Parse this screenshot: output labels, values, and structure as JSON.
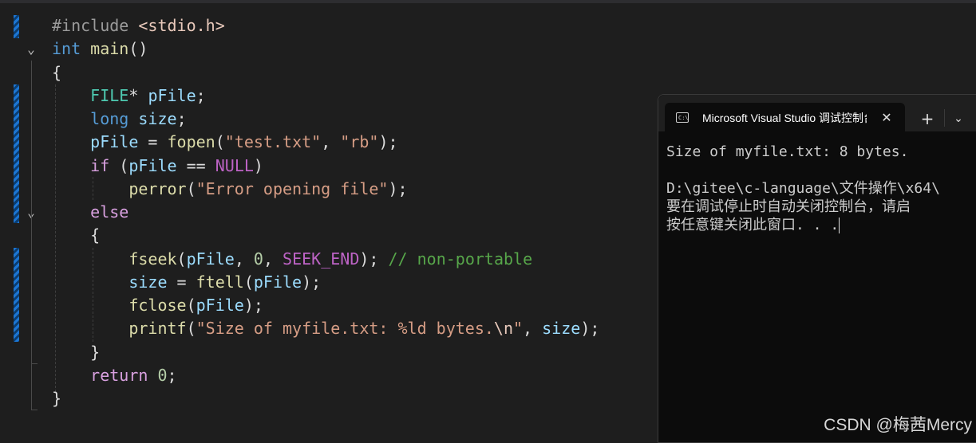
{
  "editor": {
    "code_lines": [
      [
        {
          "t": "#include ",
          "c": "pre"
        },
        {
          "t": "<stdio.h>",
          "c": "hdr"
        }
      ],
      [
        {
          "t": "int",
          "c": "kw"
        },
        {
          "t": " ",
          "c": "pun"
        },
        {
          "t": "main",
          "c": "fn"
        },
        {
          "t": "()",
          "c": "pun"
        }
      ],
      [
        {
          "t": "{",
          "c": "pun"
        }
      ],
      [
        {
          "t": "    ",
          "c": "pun"
        },
        {
          "t": "FILE",
          "c": "type"
        },
        {
          "t": "* ",
          "c": "pun"
        },
        {
          "t": "pFile",
          "c": "var"
        },
        {
          "t": ";",
          "c": "pun"
        }
      ],
      [
        {
          "t": "    ",
          "c": "pun"
        },
        {
          "t": "long",
          "c": "kw"
        },
        {
          "t": " ",
          "c": "pun"
        },
        {
          "t": "size",
          "c": "var"
        },
        {
          "t": ";",
          "c": "pun"
        }
      ],
      [
        {
          "t": "    ",
          "c": "pun"
        },
        {
          "t": "pFile",
          "c": "var"
        },
        {
          "t": " = ",
          "c": "pun"
        },
        {
          "t": "fopen",
          "c": "fn"
        },
        {
          "t": "(",
          "c": "pun"
        },
        {
          "t": "\"test.txt\"",
          "c": "str"
        },
        {
          "t": ", ",
          "c": "pun"
        },
        {
          "t": "\"rb\"",
          "c": "str"
        },
        {
          "t": ");",
          "c": "pun"
        }
      ],
      [
        {
          "t": "    ",
          "c": "pun"
        },
        {
          "t": "if",
          "c": "ctl"
        },
        {
          "t": " (",
          "c": "pun"
        },
        {
          "t": "pFile",
          "c": "var"
        },
        {
          "t": " == ",
          "c": "pun"
        },
        {
          "t": "NULL",
          "c": "mac"
        },
        {
          "t": ")",
          "c": "pun"
        }
      ],
      [
        {
          "t": "        ",
          "c": "pun"
        },
        {
          "t": "perror",
          "c": "fn"
        },
        {
          "t": "(",
          "c": "pun"
        },
        {
          "t": "\"Error opening file\"",
          "c": "str"
        },
        {
          "t": ");",
          "c": "pun"
        }
      ],
      [
        {
          "t": "    ",
          "c": "pun"
        },
        {
          "t": "else",
          "c": "ctl"
        }
      ],
      [
        {
          "t": "    {",
          "c": "pun"
        }
      ],
      [
        {
          "t": "        ",
          "c": "pun"
        },
        {
          "t": "fseek",
          "c": "fn"
        },
        {
          "t": "(",
          "c": "pun"
        },
        {
          "t": "pFile",
          "c": "var"
        },
        {
          "t": ", ",
          "c": "pun"
        },
        {
          "t": "0",
          "c": "num"
        },
        {
          "t": ", ",
          "c": "pun"
        },
        {
          "t": "SEEK_END",
          "c": "mac"
        },
        {
          "t": "); ",
          "c": "pun"
        },
        {
          "t": "// non-portable",
          "c": "cmt"
        }
      ],
      [
        {
          "t": "        ",
          "c": "pun"
        },
        {
          "t": "size",
          "c": "var"
        },
        {
          "t": " = ",
          "c": "pun"
        },
        {
          "t": "ftell",
          "c": "fn"
        },
        {
          "t": "(",
          "c": "pun"
        },
        {
          "t": "pFile",
          "c": "var"
        },
        {
          "t": ");",
          "c": "pun"
        }
      ],
      [
        {
          "t": "        ",
          "c": "pun"
        },
        {
          "t": "fclose",
          "c": "fn"
        },
        {
          "t": "(",
          "c": "pun"
        },
        {
          "t": "pFile",
          "c": "var"
        },
        {
          "t": ");",
          "c": "pun"
        }
      ],
      [
        {
          "t": "        ",
          "c": "pun"
        },
        {
          "t": "printf",
          "c": "fn"
        },
        {
          "t": "(",
          "c": "pun"
        },
        {
          "t": "\"Size of myfile.txt: %ld bytes.",
          "c": "str"
        },
        {
          "t": "\\n",
          "c": "esc"
        },
        {
          "t": "\"",
          "c": "str"
        },
        {
          "t": ", ",
          "c": "pun"
        },
        {
          "t": "size",
          "c": "var"
        },
        {
          "t": ");",
          "c": "pun"
        }
      ],
      [
        {
          "t": "    }",
          "c": "pun"
        }
      ],
      [
        {
          "t": "    ",
          "c": "pun"
        },
        {
          "t": "return",
          "c": "ctl"
        },
        {
          "t": " ",
          "c": "pun"
        },
        {
          "t": "0",
          "c": "num"
        },
        {
          "t": ";",
          "c": "pun"
        }
      ],
      [
        {
          "t": "}",
          "c": "pun"
        }
      ]
    ],
    "fold_icon": "chevron-down-icon"
  },
  "console": {
    "icon": "console-icon",
    "icon_text": "C:\\",
    "tab_title": "Microsoft Visual Studio 调试控制台",
    "close_icon": "close-icon",
    "new_tab_icon": "plus-icon",
    "new_tab_glyph": "+",
    "dropdown_icon": "chevron-down-icon",
    "dropdown_glyph": "⌄",
    "close_glyph": "✕",
    "lines": [
      "Size of myfile.txt: 8 bytes.",
      "",
      "D:\\gitee\\c-language\\文件操作\\x64\\",
      "要在调试停止时自动关闭控制台，请启",
      "按任意键关闭此窗口. . ."
    ]
  },
  "watermark": "CSDN @梅茜Mercy",
  "colors": {
    "editor_bg": "#1e1e1e",
    "console_bg": "#0c0c0c",
    "change_bar": "#1c75d2"
  }
}
